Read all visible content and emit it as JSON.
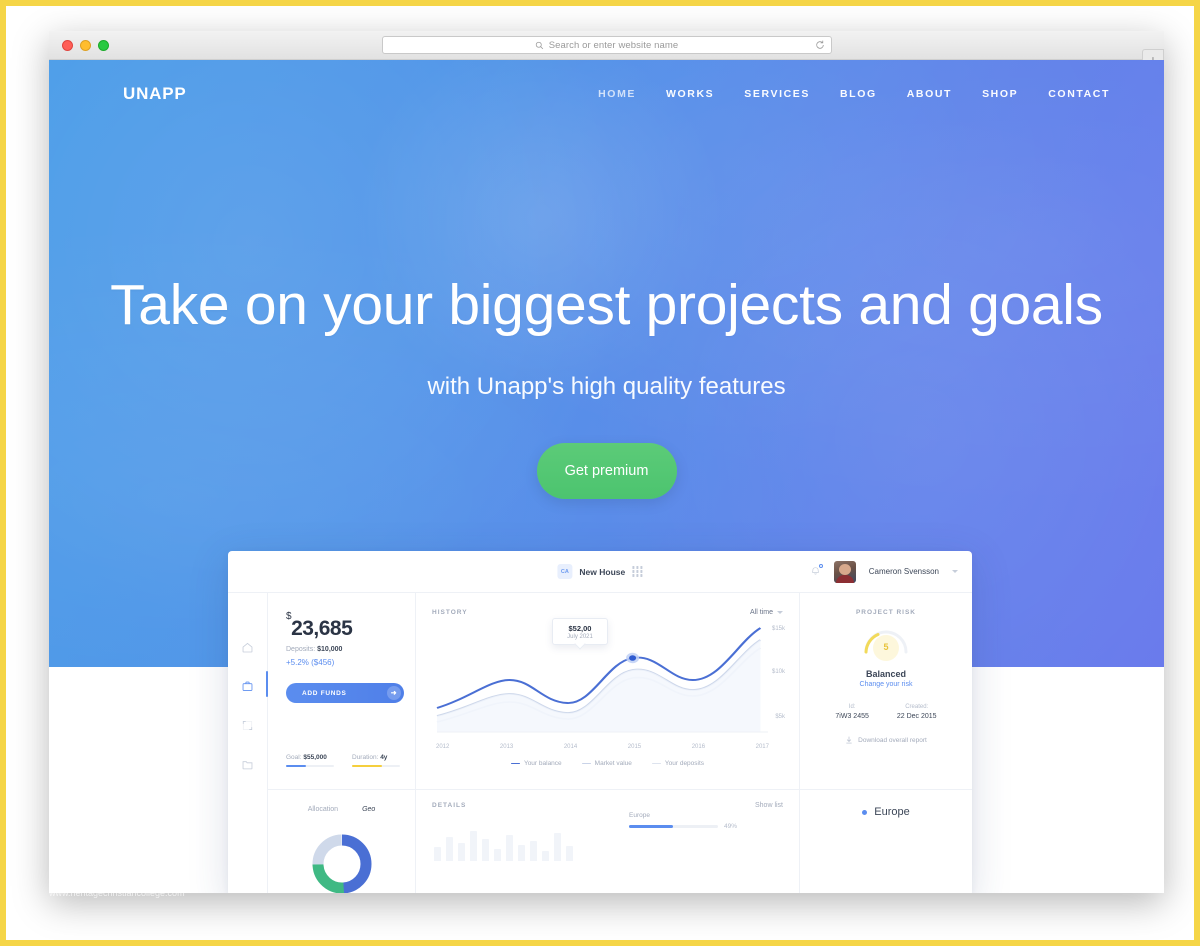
{
  "browser": {
    "address_placeholder": "Search or enter website name",
    "search_icon": "search-icon",
    "reload_icon": "reload-icon",
    "new_tab_label": "+",
    "traffic_lights": [
      "close-red",
      "minimize-yellow",
      "zoom-green"
    ]
  },
  "site": {
    "brand": "UNAPP",
    "nav": [
      {
        "label": "HOME",
        "dim": true
      },
      {
        "label": "WORKS",
        "dim": false
      },
      {
        "label": "SERVICES",
        "dim": false
      },
      {
        "label": "BLOG",
        "dim": false
      },
      {
        "label": "ABOUT",
        "dim": false
      },
      {
        "label": "SHOP",
        "dim": false
      },
      {
        "label": "CONTACT",
        "dim": false
      }
    ],
    "hero": {
      "headline": "Take on your biggest projects and goals",
      "subheadline": "with Unapp's high quality features",
      "cta_label": "Get premium",
      "cta_color": "#53c874",
      "gradient_from": "#4a9ce8",
      "gradient_to": "#6a7bec"
    },
    "watermark": "www.heritagechristiancollege.com"
  },
  "dashboard": {
    "topbar": {
      "menu_icon": "hamburger-icon",
      "project_initials": "CA",
      "project_name": "New House",
      "apps_icon": "grid-icon",
      "bell_icon": "bell-icon",
      "user_name": "Cameron Svensson",
      "caret_icon": "chevron-down-icon"
    },
    "sidebar": [
      {
        "icon": "home-icon",
        "active": false
      },
      {
        "icon": "briefcase-icon",
        "active": true
      },
      {
        "icon": "expand-icon",
        "active": false
      },
      {
        "icon": "folder-icon",
        "active": false
      }
    ],
    "balance": {
      "currency": "$",
      "amount": "23,685",
      "deposits_label": "Deposits:",
      "deposits_value": "$10,000",
      "change": "+5.2% ($456)",
      "button_label": "ADD FUNDS",
      "button_arrow": "arrow-right-icon",
      "stats": [
        {
          "label": "Goal:",
          "value": "$55,000",
          "pct": 42,
          "color": "#5b8def"
        },
        {
          "label": "Duration:",
          "value": "4y",
          "pct": 62,
          "color": "#f5cf3d"
        }
      ]
    },
    "history": {
      "title": "HISTORY",
      "filter": "All time",
      "filter_caret": "chevron-down-icon",
      "tooltip_value": "$52,00",
      "tooltip_date": "July 2021",
      "legend": [
        {
          "label": "Your balance",
          "color": "#4a6fd4"
        },
        {
          "label": "Market value",
          "color": "#c9d3e8"
        },
        {
          "label": "Your deposits",
          "color": "#dde3ee"
        }
      ]
    },
    "risk": {
      "title": "PROJECT RISK",
      "gauge_value": "5",
      "status": "Balanced",
      "link": "Change your risk",
      "meta": [
        {
          "key": "Id:",
          "value": "7iW3 2455"
        },
        {
          "key": "Created:",
          "value": "22 Dec 2015"
        }
      ],
      "download_label": "Download overall report",
      "download_icon": "download-icon"
    },
    "allocation": {
      "tabs": [
        {
          "label": "Allocation",
          "active": false
        },
        {
          "label": "Geo",
          "active": true
        }
      ],
      "slices": [
        {
          "label": "blue",
          "color": "#4a6fd4",
          "pct": 49
        },
        {
          "label": "green",
          "color": "#3fb984",
          "pct": 26
        },
        {
          "label": "light",
          "color": "#c9d3e8",
          "pct": 25
        }
      ]
    },
    "details": {
      "title": "DETAILS",
      "show_list": "Show list",
      "region_meter_label": "Europe",
      "region_meter_pct": "49%",
      "region_meter_value": 49,
      "region_name": "Europe",
      "region_dot_color": "#5b8def"
    }
  },
  "chart_data": {
    "type": "line",
    "title": "HISTORY",
    "xlabel": "",
    "ylabel": "",
    "x": [
      "2012",
      "2013",
      "2014",
      "2015",
      "2016",
      "2017"
    ],
    "ytick_labels": [
      "$15k",
      "$10k",
      "$5k"
    ],
    "ylim": [
      0,
      15
    ],
    "grid": false,
    "legend_position": "bottom",
    "highlight_point": {
      "x": "2015",
      "value": "$52,00",
      "date": "July 2021"
    },
    "series": [
      {
        "name": "Your balance",
        "color": "#4a6fd4",
        "values": [
          4.2,
          7.6,
          6.4,
          10.6,
          9.2,
          14.1
        ]
      },
      {
        "name": "Market value",
        "color": "#c9d3e8",
        "values": [
          3.1,
          5.4,
          4.6,
          9.0,
          7.8,
          12.6
        ]
      },
      {
        "name": "Your deposits",
        "color": "#dde3ee",
        "values": [
          2.6,
          4.4,
          3.8,
          8.0,
          6.9,
          11.6
        ]
      }
    ]
  }
}
